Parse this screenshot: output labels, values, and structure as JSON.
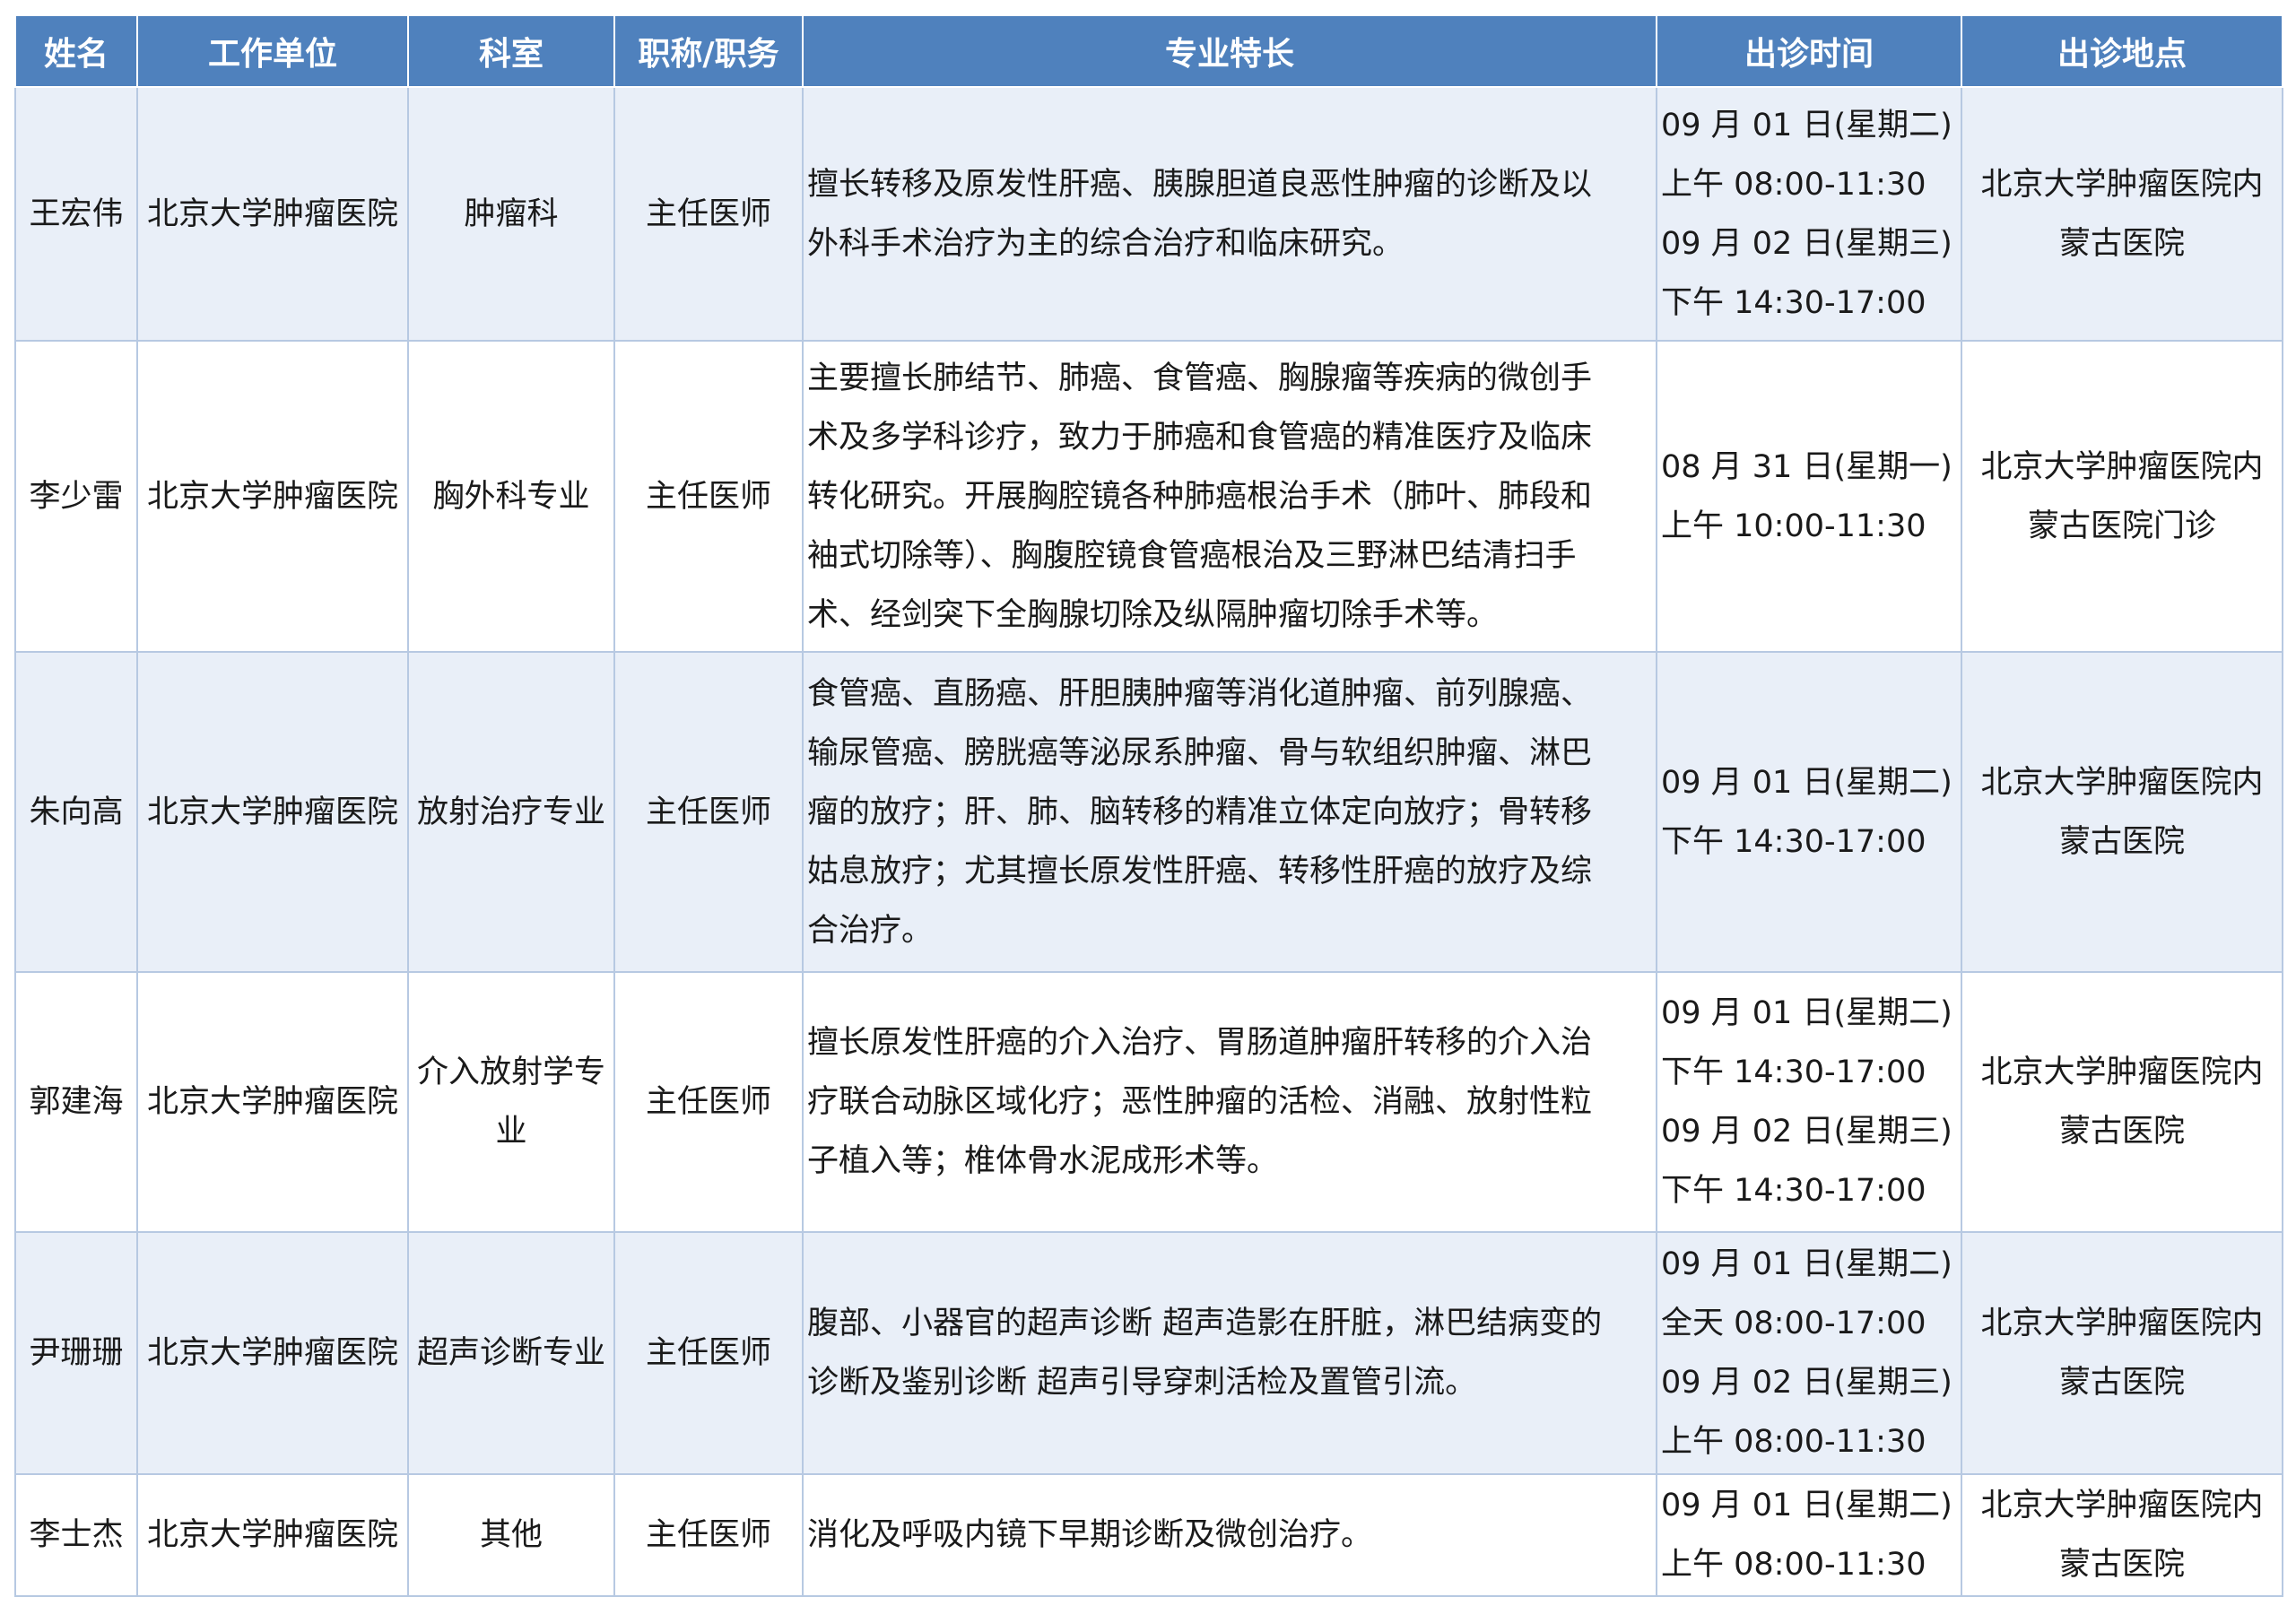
{
  "table": {
    "headers": [
      "姓名",
      "工作单位",
      "科室",
      "职称/职务",
      "专业特长",
      "出诊时间",
      "出诊地点"
    ],
    "rows": [
      {
        "name": "王宏伟",
        "unit": "北京大学肿瘤医院",
        "dept": [
          "肿瘤科"
        ],
        "title": "主任医师",
        "specialty": [
          "擅长转移及原发性肝癌、胰腺胆道良恶性肿瘤的诊断及以",
          "外科手术治疗为主的综合治疗和临床研究。"
        ],
        "time": [
          "09 月 01 日(星期二)",
          "上午 08:00-11:30",
          "09 月 02 日(星期三)",
          "下午 14:30-17:00"
        ],
        "location": [
          "北京大学肿瘤医院内",
          "蒙古医院"
        ]
      },
      {
        "name": "李少雷",
        "unit": "北京大学肿瘤医院",
        "dept": [
          "胸外科专业"
        ],
        "title": "主任医师",
        "specialty": [
          "主要擅长肺结节、肺癌、食管癌、胸腺瘤等疾病的微创手",
          "术及多学科诊疗，致力于肺癌和食管癌的精准医疗及临床",
          "转化研究。开展胸腔镜各种肺癌根治手术（肺叶、肺段和",
          "袖式切除等）、胸腹腔镜食管癌根治及三野淋巴结清扫手",
          "术、经剑突下全胸腺切除及纵隔肿瘤切除手术等。"
        ],
        "time": [
          "08 月 31 日(星期一)",
          "上午 10:00-11:30"
        ],
        "location": [
          "北京大学肿瘤医院内",
          "蒙古医院门诊"
        ]
      },
      {
        "name": "朱向高",
        "unit": "北京大学肿瘤医院",
        "dept": [
          "放射治疗专业"
        ],
        "title": "主任医师",
        "specialty": [
          "食管癌、直肠癌、肝胆胰肿瘤等消化道肿瘤、前列腺癌、",
          "输尿管癌、膀胱癌等泌尿系肿瘤、骨与软组织肿瘤、淋巴",
          "瘤的放疗；肝、肺、脑转移的精准立体定向放疗；骨转移",
          "姑息放疗；尤其擅长原发性肝癌、转移性肝癌的放疗及综",
          "合治疗。"
        ],
        "time": [
          "09 月 01 日(星期二)",
          "下午 14:30-17:00"
        ],
        "location": [
          "北京大学肿瘤医院内",
          "蒙古医院"
        ]
      },
      {
        "name": "郭建海",
        "unit": "北京大学肿瘤医院",
        "dept": [
          "介入放射学专",
          "业"
        ],
        "title": "主任医师",
        "specialty": [
          "擅长原发性肝癌的介入治疗、胃肠道肿瘤肝转移的介入治",
          "疗联合动脉区域化疗；恶性肿瘤的活检、消融、放射性粒",
          "子植入等；椎体骨水泥成形术等。"
        ],
        "time": [
          "09 月 01 日(星期二)",
          "下午 14:30-17:00",
          "09 月 02 日(星期三)",
          "下午 14:30-17:00"
        ],
        "location": [
          "北京大学肿瘤医院内",
          "蒙古医院"
        ]
      },
      {
        "name": "尹珊珊",
        "unit": "北京大学肿瘤医院",
        "dept": [
          "超声诊断专业"
        ],
        "title": "主任医师",
        "specialty": [
          "腹部、小器官的超声诊断 超声造影在肝脏，淋巴结病变的",
          "诊断及鉴别诊断 超声引导穿刺活检及置管引流。"
        ],
        "time": [
          "09 月 01 日(星期二)",
          "全天 08:00-17:00",
          "09 月 02 日(星期三)",
          "上午 08:00-11:30"
        ],
        "location": [
          "北京大学肿瘤医院内",
          "蒙古医院"
        ]
      },
      {
        "name": "李士杰",
        "unit": "北京大学肿瘤医院",
        "dept": [
          "其他"
        ],
        "title": "主任医师",
        "specialty": [
          "消化及呼吸内镜下早期诊断及微创治疗。"
        ],
        "time": [
          "09 月 01 日(星期二)",
          "上午 08:00-11:30"
        ],
        "location": [
          "北京大学肿瘤医院内",
          "蒙古医院"
        ]
      }
    ]
  }
}
